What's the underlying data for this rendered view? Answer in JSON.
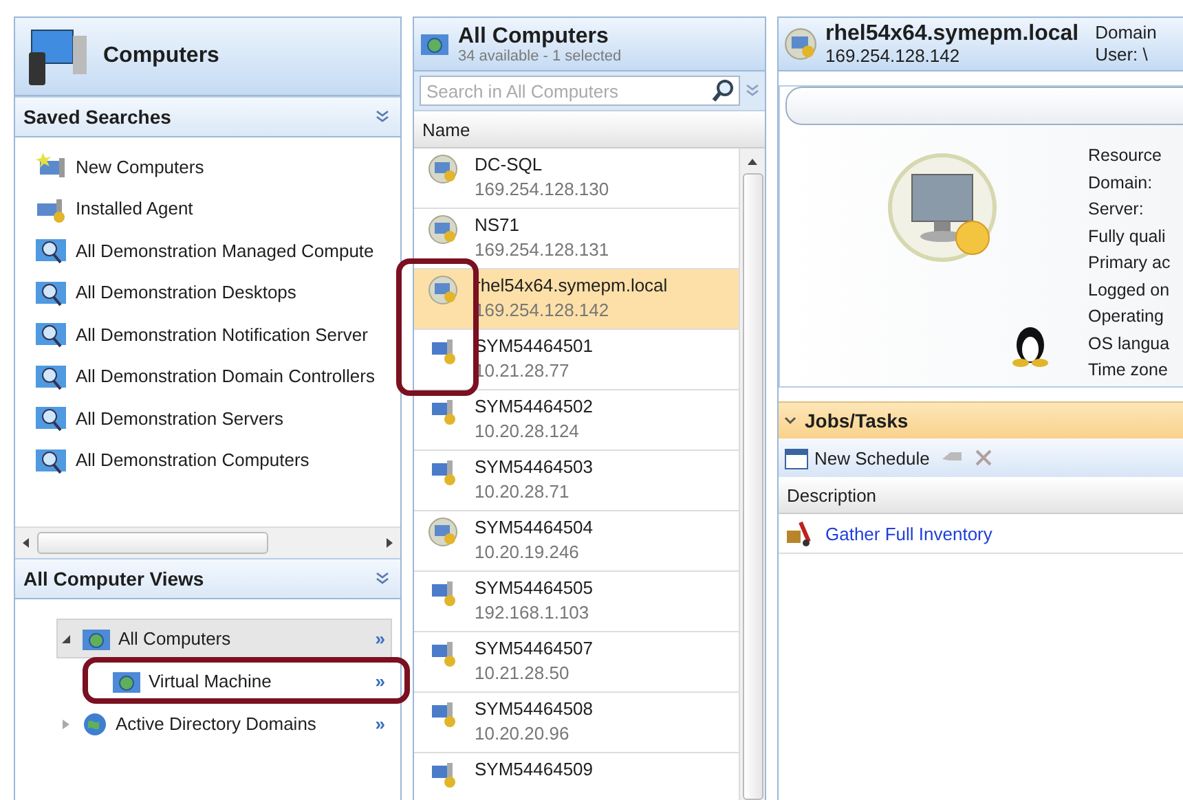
{
  "left_panel": {
    "title": "Computers",
    "saved_searches": {
      "title": "Saved Searches",
      "items": [
        {
          "label": "New Computers",
          "kind": "new"
        },
        {
          "label": "Installed Agent",
          "kind": "agent"
        },
        {
          "label": "All Demonstration Managed Compute",
          "kind": "search"
        },
        {
          "label": "All Demonstration Desktops",
          "kind": "search"
        },
        {
          "label": "All Demonstration Notification Server",
          "kind": "search"
        },
        {
          "label": "All Demonstration Domain Controllers",
          "kind": "search"
        },
        {
          "label": "All Demonstration Servers",
          "kind": "search"
        },
        {
          "label": "All Demonstration Computers",
          "kind": "search"
        }
      ]
    },
    "views": {
      "title": "All Computer Views",
      "items": [
        {
          "label": "All Computers",
          "kind": "folder",
          "selected": true,
          "expanded": true,
          "children": [
            {
              "label": "Virtual Machine",
              "kind": "folder",
              "selected": false,
              "action": "»"
            }
          ],
          "action": "»"
        },
        {
          "label": "Active Directory Domains",
          "kind": "globe",
          "selected": false,
          "expanded": false,
          "action": "»"
        }
      ]
    }
  },
  "list_panel": {
    "title": "All Computers",
    "subtitle": "34 available - 1 selected",
    "search": {
      "placeholder": "Search in All Computers"
    },
    "column": "Name",
    "rows": [
      {
        "name": "DC-SQL",
        "ip": "169.254.128.130",
        "kind": "globe",
        "selected": false
      },
      {
        "name": "NS71",
        "ip": "169.254.128.131",
        "kind": "globe",
        "selected": false
      },
      {
        "name": "rhel54x64.symepm.local",
        "ip": "169.254.128.142",
        "kind": "globe",
        "selected": true
      },
      {
        "name": "SYM54464501",
        "ip": "10.21.28.77",
        "kind": "server",
        "selected": false
      },
      {
        "name": "SYM54464502",
        "ip": "10.20.28.124",
        "kind": "server",
        "selected": false
      },
      {
        "name": "SYM54464503",
        "ip": "10.20.28.71",
        "kind": "server",
        "selected": false
      },
      {
        "name": "SYM54464504",
        "ip": "10.20.19.246",
        "kind": "globe",
        "selected": false
      },
      {
        "name": "SYM54464505",
        "ip": "192.168.1.103",
        "kind": "server",
        "selected": false
      },
      {
        "name": "SYM54464507",
        "ip": "10.21.28.50",
        "kind": "server",
        "selected": false
      },
      {
        "name": "SYM54464508",
        "ip": "10.20.20.96",
        "kind": "server",
        "selected": false
      },
      {
        "name": "SYM54464509",
        "ip": "",
        "kind": "server",
        "selected": false
      }
    ]
  },
  "detail_panel": {
    "title": "rhel54x64.symepm.local",
    "ip": "169.254.128.142",
    "header_labels": [
      "Domain",
      "User: \\"
    ],
    "properties": [
      "Resource",
      "Domain:",
      "Server:",
      "Fully quali",
      "Primary ac",
      "Logged on",
      "Operating",
      "OS langua",
      "Time zone"
    ],
    "jobs": {
      "title": "Jobs/Tasks",
      "new_button": "New Schedule",
      "column": "Description",
      "rows": [
        "Gather Full Inventory"
      ]
    }
  }
}
